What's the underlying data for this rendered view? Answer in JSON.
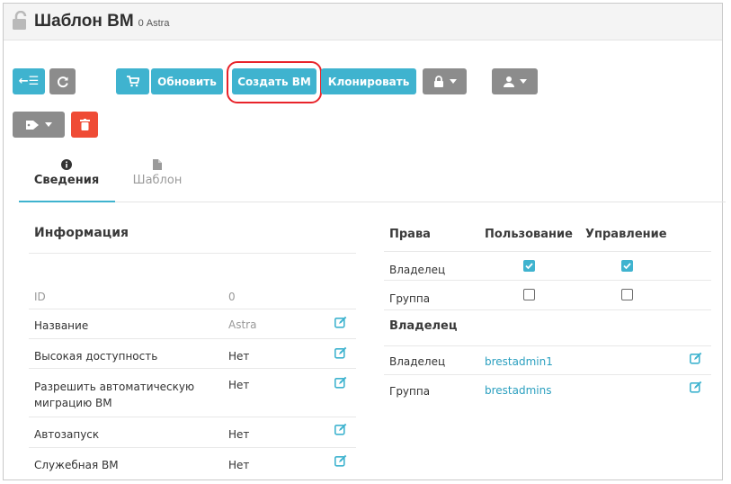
{
  "header": {
    "title": "Шаблон ВМ",
    "id": "0",
    "subtitle": "Astra"
  },
  "toolbar": {
    "back_label": "←☰",
    "refresh_icon": "refresh-icon",
    "cart_icon": "cart-icon",
    "update_label": "Обновить",
    "create_vm_label": "Создать ВМ",
    "clone_label": "Клонировать",
    "lock_icon": "lock-icon",
    "user_icon": "user-icon",
    "tag_icon": "tag-icon",
    "delete_icon": "trash-icon",
    "highlight_color": "#e8232a"
  },
  "tabs": [
    {
      "label": "Сведения",
      "icon": "info-icon",
      "active": true
    },
    {
      "label": "Шаблон",
      "icon": "file-icon",
      "active": false
    }
  ],
  "info": {
    "title": "Информация",
    "rows": [
      {
        "label": "ID",
        "value": "0",
        "editable": false,
        "muted": true
      },
      {
        "label": "Название",
        "value": "Astra",
        "editable": true,
        "muted_value": true
      },
      {
        "label": "Высокая доступность",
        "value": "Нет",
        "editable": true
      },
      {
        "label": "Разрешить автоматическую миграцию ВМ",
        "value": "Нет",
        "editable": true
      },
      {
        "label": "Автозапуск",
        "value": "Нет",
        "editable": true
      },
      {
        "label": "Служебная ВМ",
        "value": "Нет",
        "editable": true
      }
    ]
  },
  "permissions": {
    "col_rights": "Права",
    "col_use": "Пользование",
    "col_manage": "Управление",
    "rows": [
      {
        "label": "Владелец",
        "use": true,
        "manage": true
      },
      {
        "label": "Группа",
        "use": false,
        "manage": false
      }
    ]
  },
  "ownership": {
    "title": "Владелец",
    "rows": [
      {
        "label": "Владелец",
        "value": "brestadmin1"
      },
      {
        "label": "Группа",
        "value": "brestadmins"
      }
    ]
  },
  "colors": {
    "accent": "#3fb3cf",
    "gray_button": "#8c8c8c",
    "danger": "#ef4b35"
  }
}
